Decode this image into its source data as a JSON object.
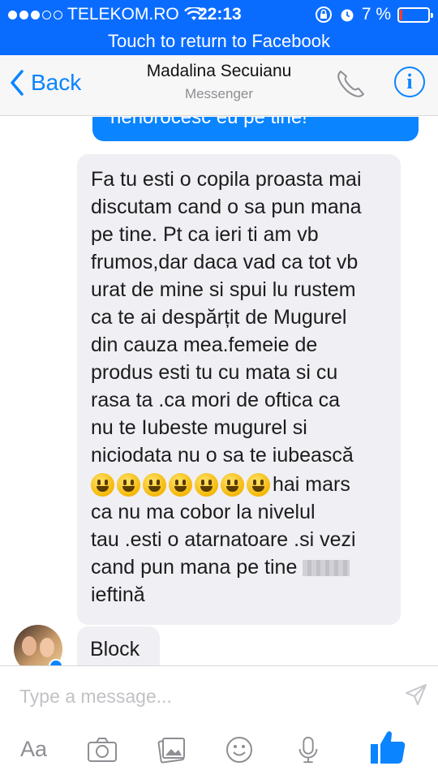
{
  "status_bar": {
    "carrier": "TELEKOM.RO",
    "time": "22:13",
    "battery_text": "7 %",
    "battery_level": 0.07,
    "signal_bars": 3,
    "signal_total": 5
  },
  "return_banner": {
    "text": "Touch to return to Facebook"
  },
  "nav": {
    "back_label": "Back",
    "title": "Madalina Secuianu",
    "subtitle": "Messenger",
    "info_glyph": "i"
  },
  "messages": {
    "sent_partial": "nenorocesc eu pe tine!",
    "received_lines": [
      "Fa tu esti o copila proasta mai",
      "discutam cand o sa pun mana",
      "pe tine. Pt ca ieri ti am vb",
      "frumos,dar daca vad ca tot vb",
      "urat de mine si spui lu rustem",
      "ca te ai despărțit de Mugurel",
      "din cauza mea.femeie de",
      "produs esti tu cu mata si cu",
      "rasa ta .ca mori de oftica ca",
      "nu te Iubeste mugurel si",
      "niciodata nu o sa te iubească"
    ],
    "emoji_text": "hai mars",
    "emoji_count": 7,
    "received_tail_lines": [
      "ca nu ma cobor la nivelul",
      "tau .esti o atarnatoare .si vezi"
    ],
    "redacted_line_prefix": "cand pun mana pe tine",
    "last_line": "ieftină",
    "block_message": "Block"
  },
  "composer": {
    "placeholder": "Type a message..."
  },
  "toolbar": {
    "text_label": "Aa",
    "icons": [
      "camera-icon",
      "gallery-icon",
      "emoji-icon",
      "microphone-icon",
      "like-icon"
    ]
  },
  "colors": {
    "brand_blue": "#0a6cff",
    "link_blue": "#0a84ff",
    "bubble_gray": "#efeff4",
    "battery_red": "#ff3b30"
  }
}
